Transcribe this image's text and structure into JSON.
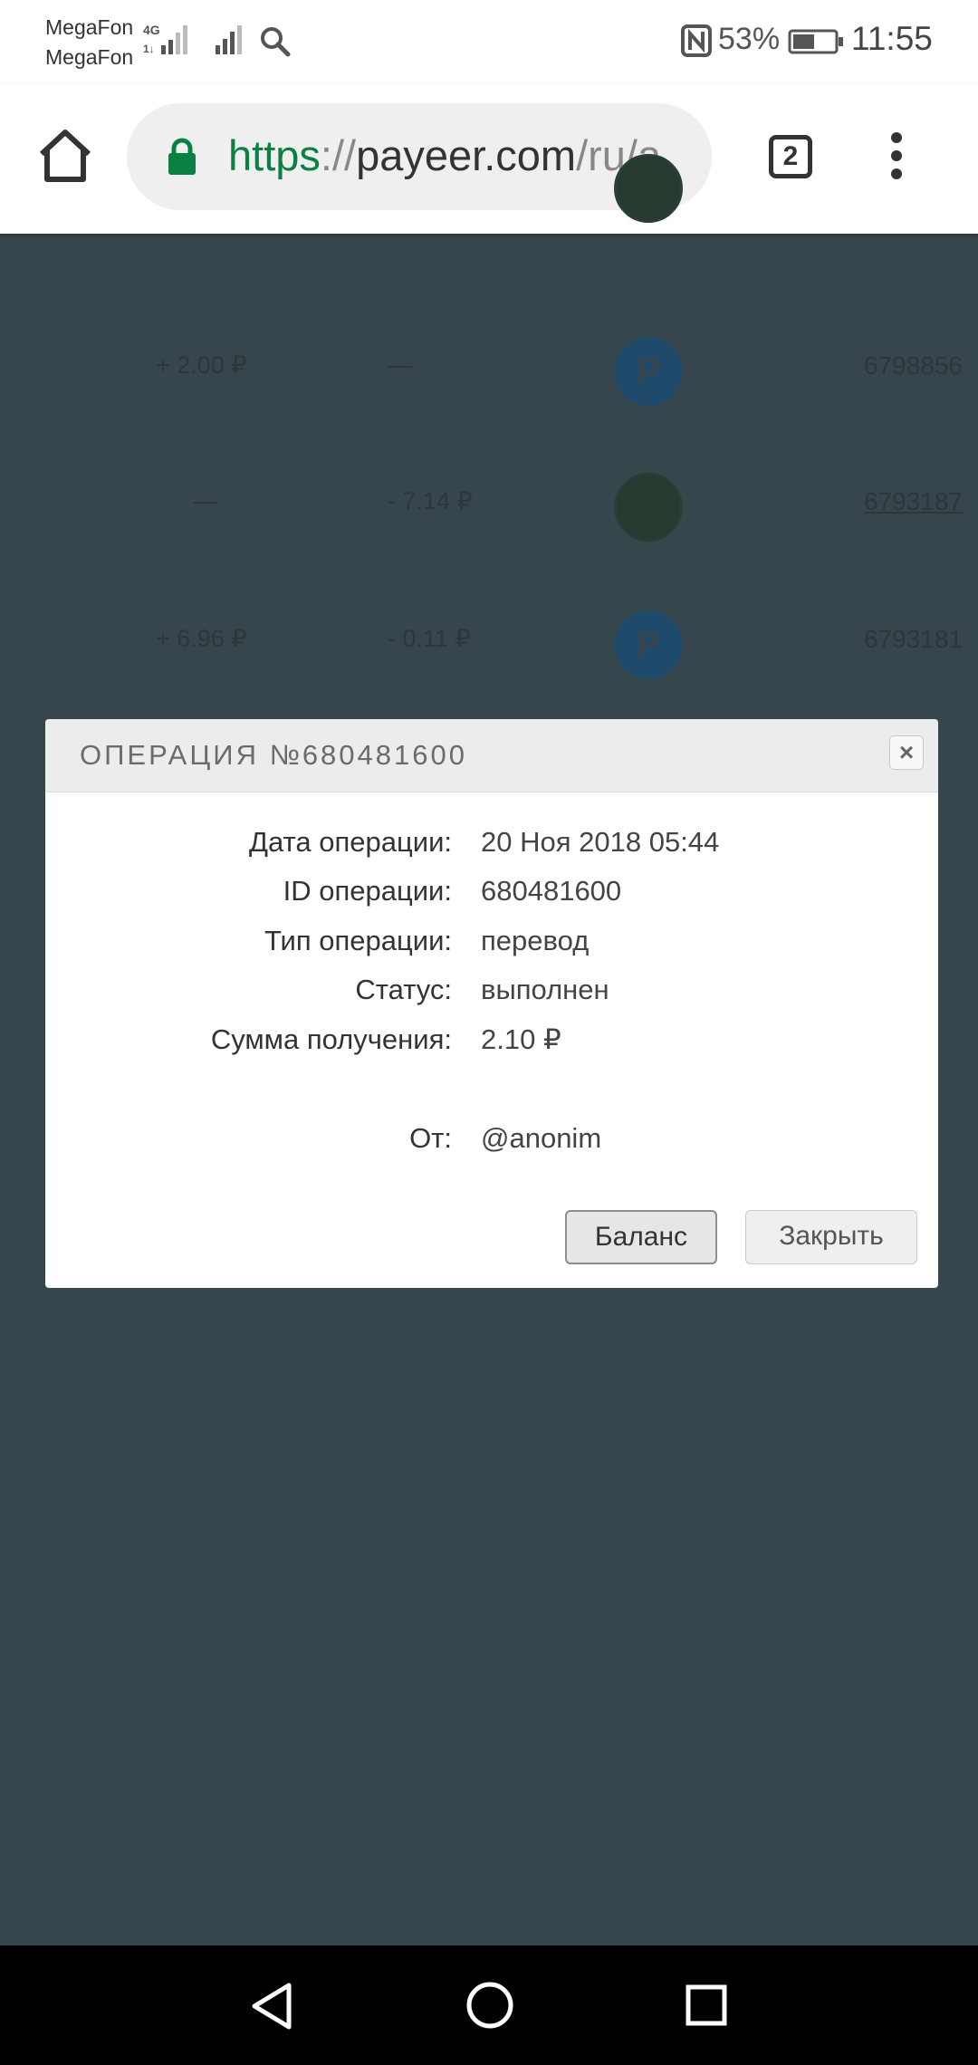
{
  "status_bar": {
    "carrier_1": "MegaFon",
    "carrier_2": "MegaFon",
    "network_type": "4G",
    "battery_percent": "53%",
    "battery_level": 0.53,
    "time": "11:55"
  },
  "browser": {
    "url_scheme": "https",
    "url_separator": "://",
    "url_host": "payeer.com",
    "url_path": "/ru/a",
    "tab_count": "2",
    "accent_color": "#0b8043"
  },
  "background_table": [
    {
      "amount_in": "+ 2.00 ₽",
      "amount_out": "—",
      "icon": "payeer-icon",
      "id": "6798856"
    },
    {
      "amount_in": "—",
      "amount_out": "- 7.14 ₽",
      "icon": "wallet-icon",
      "id": "6793187"
    },
    {
      "amount_in": "+ 6.96 ₽",
      "amount_out": "- 0.11 ₽",
      "icon": "payeer-icon",
      "id": "6793181"
    }
  ],
  "modal": {
    "title": "ОПЕРАЦИЯ №680481600",
    "close_icon": "×",
    "fields": [
      {
        "label": "Дата операции:",
        "value": "20 Ноя 2018 05:44"
      },
      {
        "label": "ID операции:",
        "value": "680481600"
      },
      {
        "label": "Тип операции:",
        "value": "перевод"
      },
      {
        "label": "Статус:",
        "value": "выполнен"
      },
      {
        "label": "Сумма получения:",
        "value": "2.10 ₽"
      }
    ],
    "from": {
      "label": "От:",
      "value": "@anonim"
    },
    "buttons": {
      "balance": "Баланс",
      "close": "Закрыть"
    }
  }
}
